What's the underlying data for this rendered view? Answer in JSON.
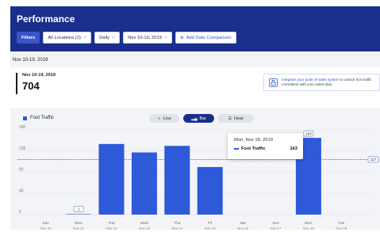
{
  "header": {
    "title": "Performance",
    "filters_label": "Filters",
    "locations_label": "All Locations (2)",
    "interval_label": "Daily",
    "date_range_label": "Nov 10-19, 2019",
    "comparison_label": "Add Date Comparison",
    "comparison_icon": "plus-circle-icon"
  },
  "summary": {
    "date_range": "Nov 10-19, 2019",
    "kpi_date": "Nov 10-19, 2019",
    "kpi_value": "704"
  },
  "promo": {
    "icon": "lock-icon",
    "link_text": "Integrate your point of sales system",
    "rest_text": " to unlock foot traffic correlation with your sales data"
  },
  "legend": {
    "label": "Foot Traffic"
  },
  "view_toggle": {
    "line_label": "Line",
    "bar_label": "Bar",
    "heat_label": "Heat",
    "active": "Bar"
  },
  "tooltip": {
    "date": "Mon, Nov 18, 2019",
    "series": "Foot Traffic",
    "value": "163"
  },
  "colors": {
    "header_bg": "#1a2f8c",
    "bar": "#2e59d9",
    "average_line": "#2e59d9",
    "background": "#f3f4f7"
  },
  "chart_data": {
    "type": "bar",
    "title": "",
    "xlabel": "",
    "ylabel": "",
    "ylim": [
      0,
      180
    ],
    "yticks": [
      0,
      45,
      90,
      135,
      180
    ],
    "categories": [
      [
        "Sun",
        "Nov 10"
      ],
      [
        "Mon",
        "Nov 11"
      ],
      [
        "Tue",
        "Nov 12"
      ],
      [
        "Wed",
        "Nov 13"
      ],
      [
        "Thu",
        "Nov 14"
      ],
      [
        "Fri",
        "Nov 15"
      ],
      [
        "Sat",
        "Nov 16"
      ],
      [
        "Sun",
        "Nov 17"
      ],
      [
        "Mon",
        "Nov 18"
      ],
      [
        "Tue",
        "Nov 19"
      ]
    ],
    "series": [
      {
        "name": "Foot Traffic",
        "values": [
          0,
          1,
          150,
          132,
          146,
          101,
          0,
          0,
          163,
          0
        ]
      }
    ],
    "value_labels": [
      {
        "index": 1,
        "text": "1"
      },
      {
        "index": 8,
        "text": "163"
      }
    ],
    "average": {
      "value": 117,
      "label": "117"
    },
    "grid": true,
    "legend": "top-left"
  }
}
